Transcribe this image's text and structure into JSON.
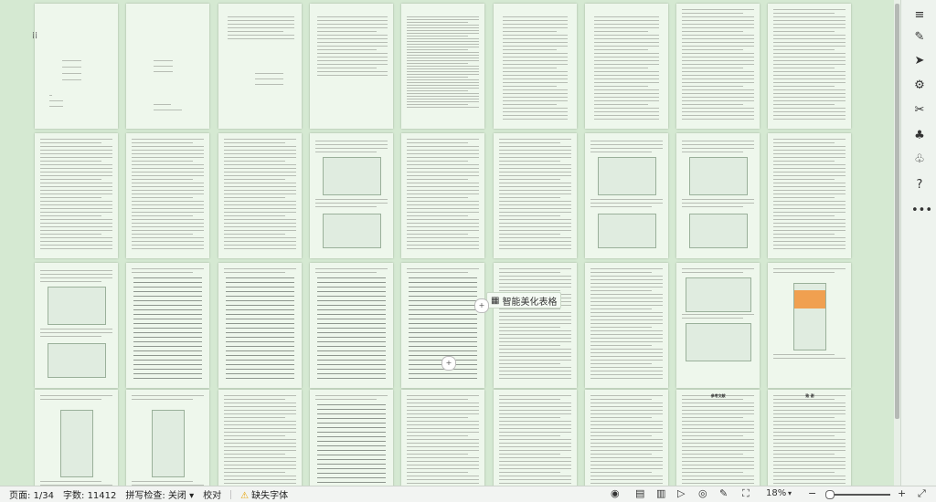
{
  "status": {
    "page": "页面: 1/34",
    "words": "字数: 11412",
    "spellcheck": "拼写检查: 关闭",
    "proofread": "校对",
    "missing_fonts": "缺失字体",
    "zoom": "18%"
  },
  "popup": {
    "beautify_label": "智能美化表格"
  },
  "pages": {
    "cover_logo": "衡水学院",
    "cover_title": "基础信息管理功能小程序设计与实现",
    "en_title": "Design and Implementation of WeChat Mini Program for Lecture Information Management",
    "abstract_cn": "摘 要",
    "abstract_en": "Abstract",
    "toc": "目 录",
    "ack": "致 谢",
    "refs": "参考文献"
  },
  "icons": {
    "toolbar": [
      "menu-icon",
      "pen-icon",
      "select-icon",
      "settings-icon",
      "tools-icon",
      "shirt-icon",
      "shirt-outline-icon",
      "help-icon",
      "more-icon"
    ],
    "statusbar": [
      "eye-icon",
      "read-mode-icon",
      "page-view-icon",
      "play-icon",
      "globe-icon",
      "edit-icon",
      "fit-icon"
    ]
  }
}
